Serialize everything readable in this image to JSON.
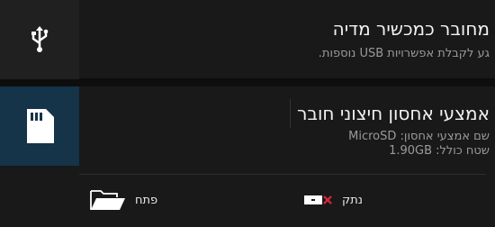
{
  "usb_notification": {
    "title": "מחובר כמכשיר מדיה",
    "subtitle": "גע לקבלת אפשרויות USB נוספות.",
    "icon": "usb-icon"
  },
  "sd_notification": {
    "title": "אמצעי אחסון חיצוני חובר",
    "detail_name": "שם אמצעי אחסון: MicroSD",
    "detail_size": "שטח כולל: 1.90GB",
    "icon": "sd-card-icon",
    "actions": {
      "unmount_label": "נתק",
      "open_label": "פתח"
    }
  },
  "colors": {
    "background": "#0e0e0e",
    "notification_bg": "#191919",
    "sd_icon_bg": "#153349",
    "unmount_accent": "#e0263a"
  }
}
